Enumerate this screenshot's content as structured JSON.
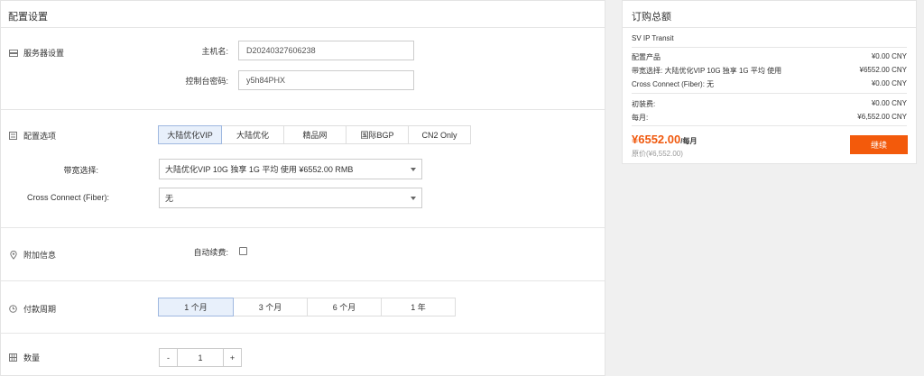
{
  "config": {
    "title": "配置设置",
    "server": {
      "section_label": "服务器设置",
      "hostname_label": "主机名:",
      "hostname_value": "D20240327606238",
      "password_label": "控制台密码:",
      "password_value": "y5h84PHX"
    },
    "options": {
      "section_label": "配置选项",
      "tabs": [
        "大陆优化VIP",
        "大陆优化",
        "精品网",
        "国际BGP",
        "CN2 Only"
      ],
      "active_tab": 0,
      "bandwidth_label": "带宽选择:",
      "bandwidth_value": "大陆优化VIP 10G 独享 1G 平均 使用 ¥6552.00 RMB",
      "cross_connect_label": "Cross Connect (Fiber):",
      "cross_connect_value": "无"
    },
    "addon": {
      "section_label": "附加信息",
      "auto_renew_label": "自动续费:",
      "auto_renew_checked": false
    },
    "billing": {
      "section_label": "付款周期",
      "cycles": [
        "1 个月",
        "3 个月",
        "6 个月",
        "1 年"
      ],
      "active_cycle": 0
    },
    "quantity": {
      "section_label": "数量",
      "minus": "-",
      "value": "1",
      "plus": "+"
    }
  },
  "summary": {
    "title": "订购总额",
    "product": "SV IP Transit",
    "items": [
      {
        "label": "配置产品",
        "value": "¥0.00 CNY"
      },
      {
        "label": "带宽选择: 大陆优化VIP 10G 独享 1G 平均 使用",
        "value": "¥6552.00 CNY"
      },
      {
        "label": "Cross Connect (Fiber): 无",
        "value": "¥0.00 CNY"
      }
    ],
    "setup_label": "初装费:",
    "setup_value": "¥0.00 CNY",
    "monthly_label": "每月:",
    "monthly_value": "¥6,552.00 CNY",
    "total_price": "¥6552.00",
    "total_period": "/每月",
    "original_price": "原价(¥6,552.00)",
    "continue_label": "继续"
  },
  "colors": {
    "accent": "#f35a0b",
    "active_tab_bg": "#e8f0fb"
  }
}
